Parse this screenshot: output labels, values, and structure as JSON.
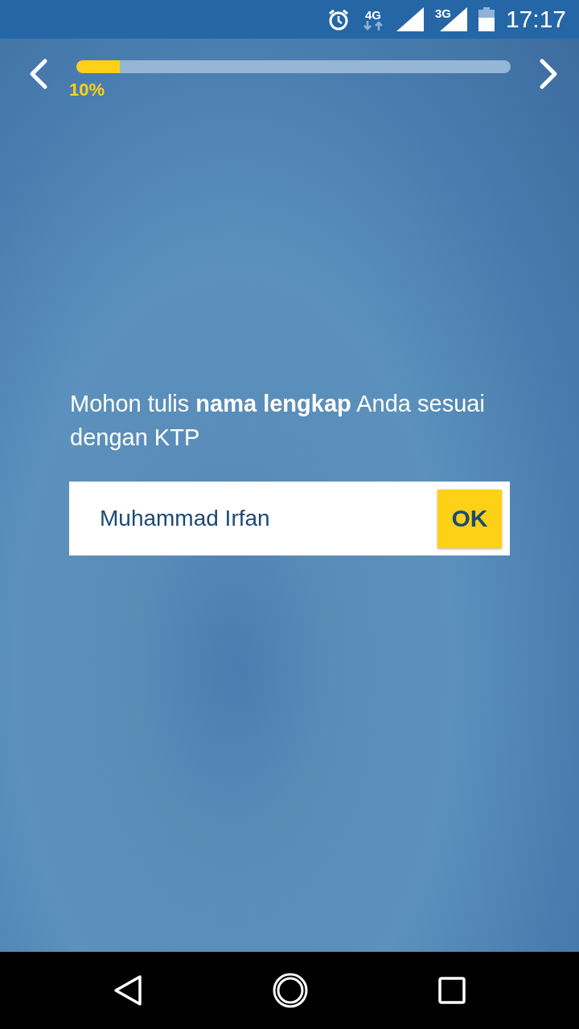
{
  "status_bar": {
    "network_4g": "4G",
    "network_3g": "3G",
    "time": "17:17"
  },
  "progress": {
    "level": 0.1,
    "label": "10%"
  },
  "prompt": "Mohon tulis **nama lengkap** Anda sesuai dengan KTP",
  "name_field": {
    "value": "Muhammad Irfan"
  },
  "ok_button": "OK"
}
